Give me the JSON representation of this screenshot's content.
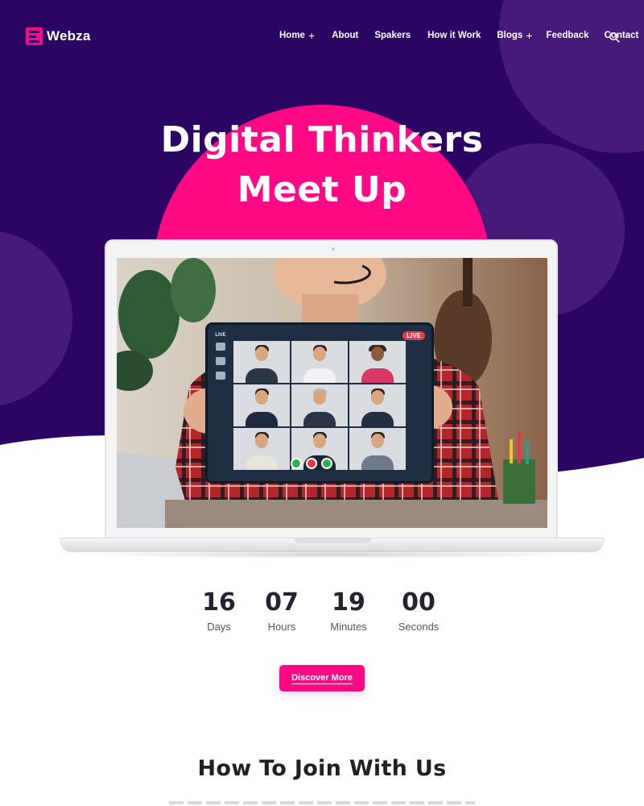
{
  "brand": {
    "name": "Webza",
    "accent": "#ff0a84",
    "hero_color": "#2b0563"
  },
  "nav": {
    "items": [
      {
        "label": "Home",
        "has_submenu": true
      },
      {
        "label": "About",
        "has_submenu": false
      },
      {
        "label": "Spakers",
        "has_submenu": false
      },
      {
        "label": "How it Work",
        "has_submenu": false
      },
      {
        "label": "Blogs",
        "has_submenu": true
      },
      {
        "label": "Feedback",
        "has_submenu": false
      },
      {
        "label": "Contact",
        "has_submenu": false
      }
    ],
    "search_icon": "search-icon"
  },
  "hero": {
    "title_line1": "Digital Thinkers",
    "title_line2": "Meet Up",
    "live_label": "LIVE"
  },
  "countdown": {
    "days": {
      "value": "16",
      "label": "Days"
    },
    "hours": {
      "value": "07",
      "label": "Hours"
    },
    "minutes": {
      "value": "19",
      "label": "Minutes"
    },
    "seconds": {
      "value": "00",
      "label": "Seconds"
    }
  },
  "cta": {
    "label": "Discover More"
  },
  "section": {
    "title": "How To Join With Us"
  }
}
